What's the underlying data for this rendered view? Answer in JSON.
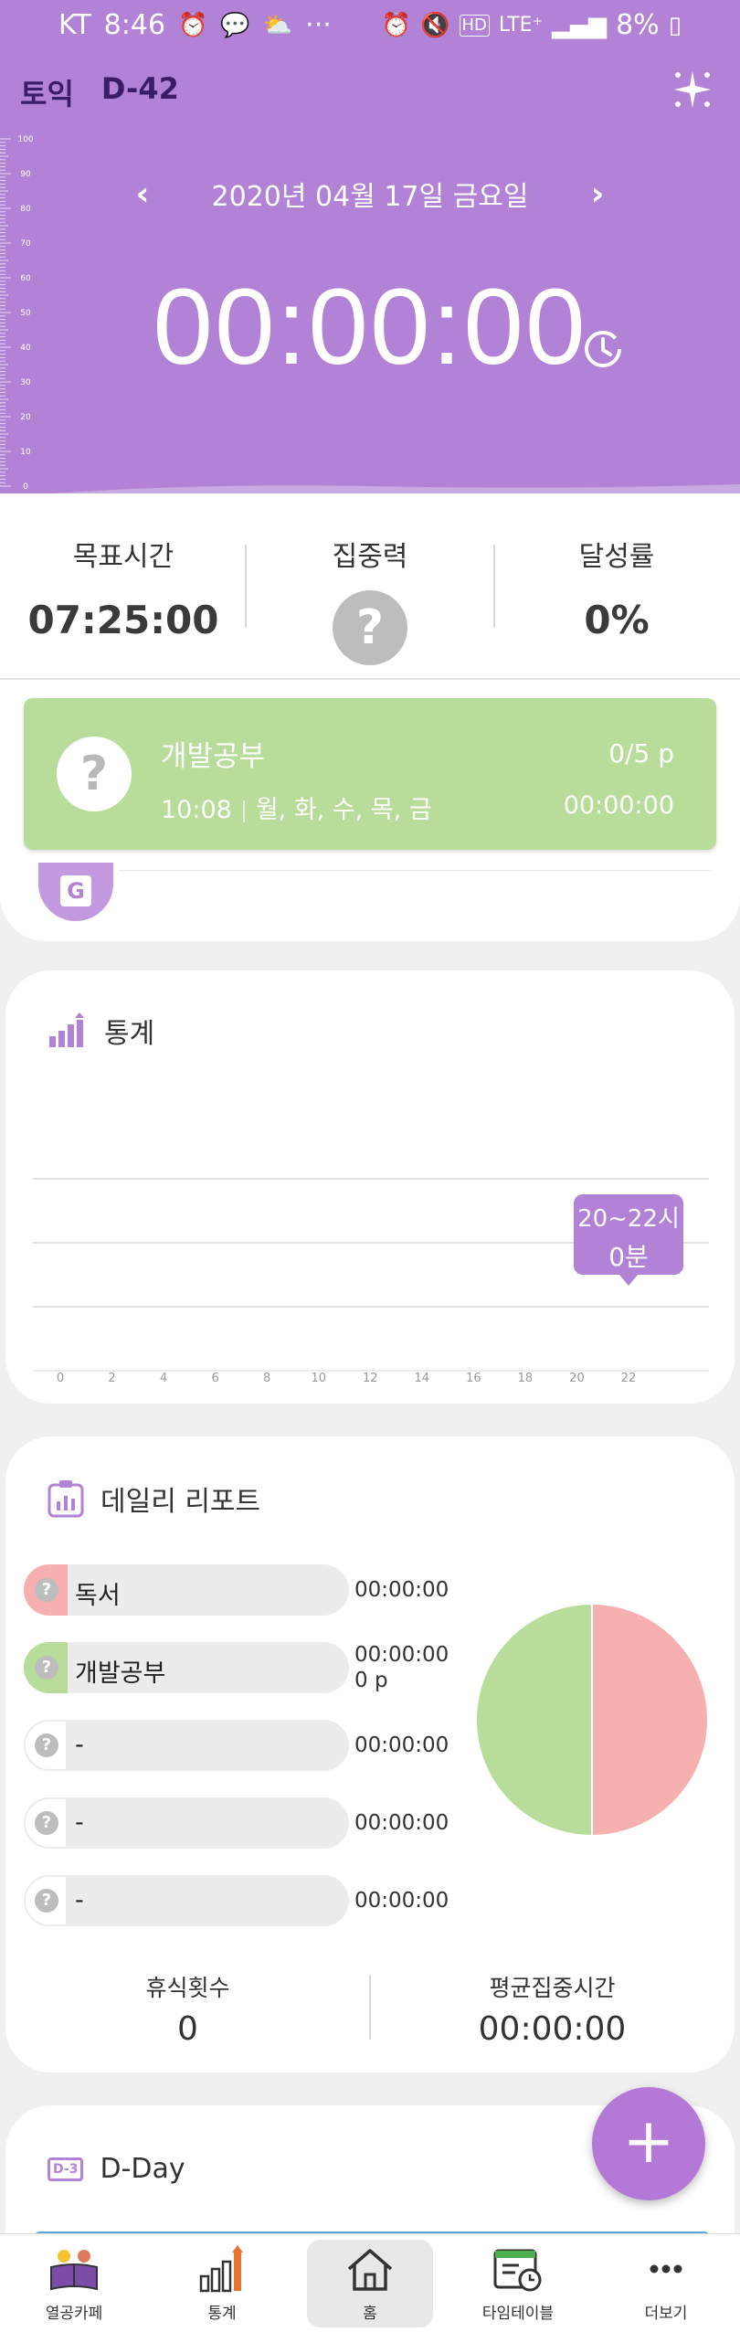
{
  "status_bar": {
    "carrier": "KT",
    "time": "8:46",
    "dots": "···",
    "network": "LTE⁺",
    "battery": "8%"
  },
  "header": {
    "exam": "토익",
    "dday": "D-42"
  },
  "ruler_labels": [
    "100",
    "90",
    "80",
    "70",
    "60",
    "50",
    "40",
    "30",
    "20",
    "10",
    "0"
  ],
  "date_nav": {
    "prev": "‹",
    "date": "2020년 04월 17일 금요일",
    "next": "›"
  },
  "timer": "00:00:00",
  "summary": {
    "goal_label": "목표시간",
    "goal_value": "07:25:00",
    "focus_label": "집중력",
    "focus_value": "?",
    "achieve_label": "달성률",
    "achieve_value": "0%"
  },
  "subject": {
    "icon": "?",
    "name": "개발공부",
    "time": "10:08",
    "days": "월, 화, 수, 목, 금",
    "pages": "0/5 p",
    "elapsed": "00:00:00"
  },
  "badge_letter": "G",
  "stats": {
    "title": "통계",
    "x_ticks": [
      "0",
      "2",
      "4",
      "6",
      "8",
      "10",
      "12",
      "14",
      "16",
      "18",
      "20",
      "22"
    ],
    "tooltip_range": "20~22시",
    "tooltip_value": "0분"
  },
  "chart_data": {
    "type": "bar",
    "categories": [
      "0",
      "2",
      "4",
      "6",
      "8",
      "10",
      "12",
      "14",
      "16",
      "18",
      "20",
      "22"
    ],
    "values": [
      0,
      0,
      0,
      0,
      0,
      0,
      0,
      0,
      0,
      0,
      0,
      0
    ],
    "title": "통계",
    "xlabel": "",
    "ylabel": ""
  },
  "daily": {
    "title": "데일리 리포트",
    "rows": [
      {
        "name": "독서",
        "time": "00:00:00",
        "pages": "",
        "color": "#f6b0b0"
      },
      {
        "name": "개발공부",
        "time": "00:00:00",
        "pages": "0 p",
        "color": "#b8dd9b"
      },
      {
        "name": "-",
        "time": "00:00:00",
        "pages": "",
        "color": "#ececec"
      },
      {
        "name": "-",
        "time": "00:00:00",
        "pages": "",
        "color": "#ececec"
      },
      {
        "name": "-",
        "time": "00:00:00",
        "pages": "",
        "color": "#ececec"
      }
    ],
    "pie": [
      {
        "label": "독서",
        "value": 50,
        "color": "#f6b0b0"
      },
      {
        "label": "개발공부",
        "value": 50,
        "color": "#b8dd9b"
      }
    ],
    "rest_label": "휴식횟수",
    "rest_value": "0",
    "avg_label": "평균집중시간",
    "avg_value": "00:00:00"
  },
  "dday_card": {
    "icon": "D-3",
    "title": "D-Day"
  },
  "fab": "+",
  "nav": [
    {
      "label": "열공카페",
      "icon": "cafe-icon"
    },
    {
      "label": "통계",
      "icon": "stats-icon"
    },
    {
      "label": "홈",
      "icon": "home-icon"
    },
    {
      "label": "타임테이블",
      "icon": "timetable-icon"
    },
    {
      "label": "더보기",
      "icon": "more-icon"
    }
  ],
  "colors": {
    "purple": "#b282d6",
    "green": "#b8dd9b",
    "pink": "#f6b0b0"
  }
}
